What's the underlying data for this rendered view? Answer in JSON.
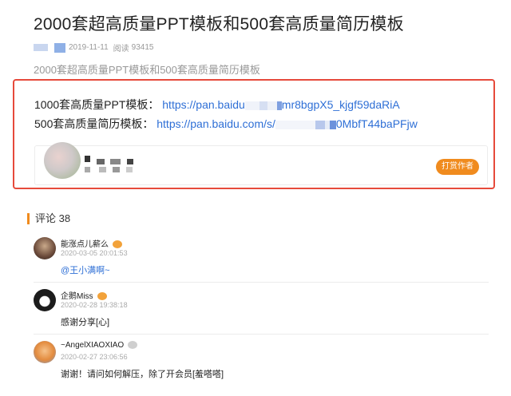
{
  "article": {
    "title": "2000套超高质量PPT模板和500套高质量简历模板",
    "date": "2019-11-11",
    "views_label": "阅读",
    "views": "93415",
    "summary": "2000套超高质量PPT模板和500套高质量简历模板",
    "links": [
      {
        "label": "1000套高质量PPT模板：",
        "url_start": "https://pan.baidu",
        "url_end": "mr8bgpX5_kjgf59daRiA"
      },
      {
        "label": "500套高质量简历模板：",
        "url_start": "https://pan.baidu.com/s/",
        "url_end": "0MbfT44baPFjw"
      }
    ]
  },
  "author_card": {
    "reward_label": "打赏作者"
  },
  "comments_header": {
    "label": "评论",
    "count": "38"
  },
  "comments": [
    {
      "name": "能涨点儿薪么",
      "time": "2020-03-05 20:01:53",
      "text": "@王小满啊~",
      "is_mention": true
    },
    {
      "name": "企鹅Miss",
      "time": "2020-02-28 19:38:18",
      "text": "感谢分享[心]",
      "is_mention": false
    },
    {
      "name": "~AngelXIAOXIAO",
      "time": "2020-02-27 23:06:56",
      "text": "谢谢！请问如何解压，除了开会员[羞嗒嗒]",
      "is_mention": false
    }
  ],
  "colors": {
    "accent": "#f08b1e",
    "link": "#2e6fd6",
    "highlight": "#e64a3b"
  }
}
